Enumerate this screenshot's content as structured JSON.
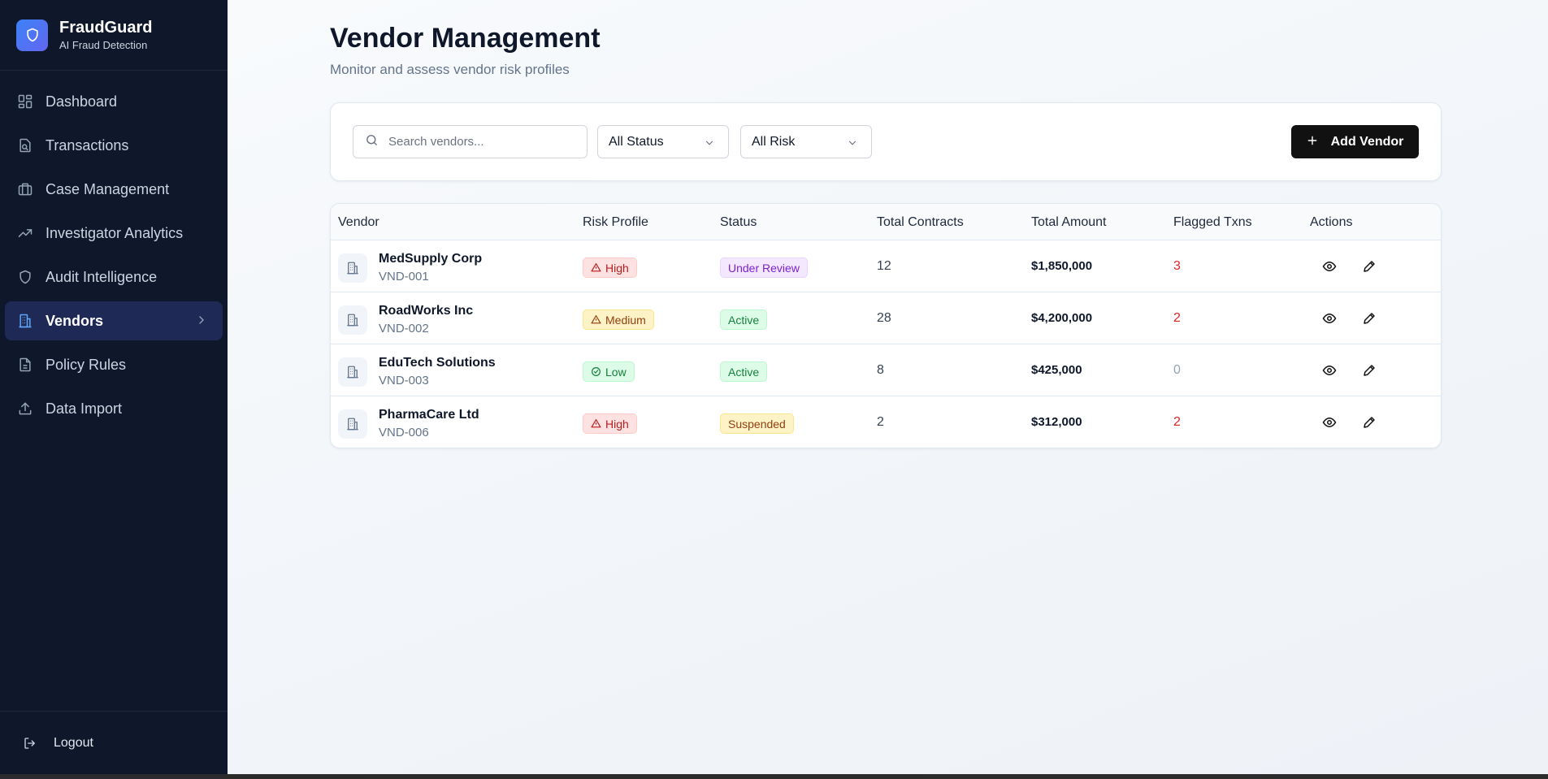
{
  "app": {
    "name": "FraudGuard",
    "tagline": "AI Fraud Detection"
  },
  "sidebar": {
    "items": [
      {
        "label": "Dashboard"
      },
      {
        "label": "Transactions"
      },
      {
        "label": "Case Management"
      },
      {
        "label": "Investigator Analytics"
      },
      {
        "label": "Audit Intelligence"
      },
      {
        "label": "Vendors",
        "active": true
      },
      {
        "label": "Policy Rules"
      },
      {
        "label": "Data Import"
      }
    ],
    "logout_label": "Logout"
  },
  "page": {
    "title": "Vendor Management",
    "subtitle": "Monitor and assess vendor risk profiles"
  },
  "filters": {
    "search_placeholder": "Search vendors...",
    "status_selected": "All Status",
    "risk_selected": "All Risk",
    "add_label": "Add Vendor"
  },
  "table": {
    "headers": [
      "Vendor",
      "Risk Profile",
      "Status",
      "Total Contracts",
      "Total Amount",
      "Flagged Txns",
      "Actions"
    ],
    "rows": [
      {
        "name": "MedSupply Corp",
        "id": "VND-001",
        "risk": "High",
        "status": "Under Review",
        "contracts": "12",
        "amount": "$1,850,000",
        "flagged": "3"
      },
      {
        "name": "RoadWorks Inc",
        "id": "VND-002",
        "risk": "Medium",
        "status": "Active",
        "contracts": "28",
        "amount": "$4,200,000",
        "flagged": "2"
      },
      {
        "name": "EduTech Solutions",
        "id": "VND-003",
        "risk": "Low",
        "status": "Active",
        "contracts": "8",
        "amount": "$425,000",
        "flagged": "0"
      },
      {
        "name": "PharmaCare Ltd",
        "id": "VND-006",
        "risk": "High",
        "status": "Suspended",
        "contracts": "2",
        "amount": "$312,000",
        "flagged": "2"
      }
    ]
  },
  "colors": {
    "sidebar_bg": "#0f172a",
    "accent": "#3b82f6",
    "primary_button": "#111111",
    "risk_high": "#b91c1c",
    "flag_red": "#dc2626"
  }
}
